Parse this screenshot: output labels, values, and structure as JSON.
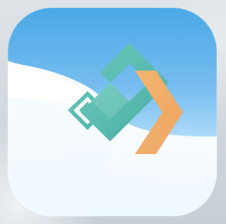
{
  "app_icon": {
    "colors": {
      "teal": "#53b7ad",
      "teal_light": "#64c3b8",
      "orange": "#f0ad68",
      "white": "#ffffff",
      "sky_top": "#4aa8e6",
      "sky_bottom": "#def2ff"
    },
    "icon_name": "app-logo-icon"
  }
}
